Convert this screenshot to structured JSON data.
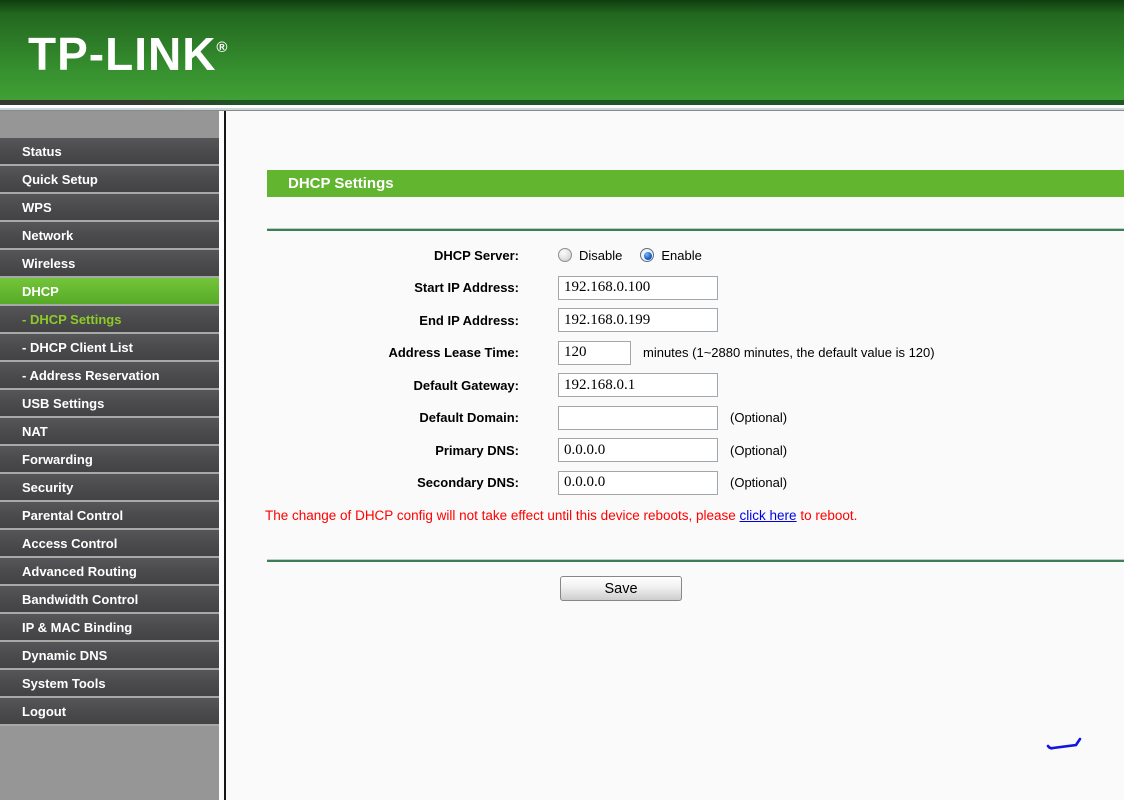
{
  "brand": {
    "name": "TP-LINK",
    "registered": "®"
  },
  "sidebar": {
    "items": [
      {
        "label": "Status"
      },
      {
        "label": "Quick Setup"
      },
      {
        "label": "WPS"
      },
      {
        "label": "Network"
      },
      {
        "label": "Wireless"
      },
      {
        "label": "DHCP",
        "active": true
      },
      {
        "label": "- DHCP Settings",
        "sub": true,
        "selected": true
      },
      {
        "label": "- DHCP Client List",
        "sub": true
      },
      {
        "label": "- Address Reservation",
        "sub": true
      },
      {
        "label": "USB Settings"
      },
      {
        "label": "NAT"
      },
      {
        "label": "Forwarding"
      },
      {
        "label": "Security"
      },
      {
        "label": "Parental Control"
      },
      {
        "label": "Access Control"
      },
      {
        "label": "Advanced Routing"
      },
      {
        "label": "Bandwidth Control"
      },
      {
        "label": "IP & MAC Binding"
      },
      {
        "label": "Dynamic DNS"
      },
      {
        "label": "System Tools"
      },
      {
        "label": "Logout"
      }
    ]
  },
  "page": {
    "title": "DHCP Settings",
    "dhcp_server_label": "DHCP Server:",
    "radio_options": [
      {
        "label": "Disable",
        "checked": false
      },
      {
        "label": "Enable",
        "checked": true
      }
    ],
    "fields": [
      {
        "label": "Start IP Address:",
        "value": "192.168.0.100",
        "size": "normal",
        "suffix": ""
      },
      {
        "label": "End IP Address:",
        "value": "192.168.0.199",
        "size": "normal",
        "suffix": ""
      },
      {
        "label": "Address Lease Time:",
        "value": "120",
        "size": "small",
        "suffix": "minutes (1~2880 minutes, the default value is 120)"
      },
      {
        "label": "Default Gateway:",
        "value": "192.168.0.1",
        "size": "normal",
        "suffix": ""
      },
      {
        "label": "Default Domain:",
        "value": "",
        "size": "normal",
        "suffix": "(Optional)"
      },
      {
        "label": "Primary DNS:",
        "value": "0.0.0.0",
        "size": "normal",
        "suffix": "(Optional)"
      },
      {
        "label": "Secondary DNS:",
        "value": "0.0.0.0",
        "size": "normal",
        "suffix": "(Optional)"
      }
    ],
    "warning": {
      "pre": "The change of DHCP config will not take effect until this device reboots, please ",
      "link_text": "click here",
      "post": " to reboot."
    },
    "save_label": "Save"
  },
  "colors": {
    "accent_green": "#62b52e",
    "submenu_selected_green": "#8ccc29",
    "separator_green": "#3e7d55",
    "sidebar_item_gray": "#4b4b4d",
    "sidebar_background": "#969696",
    "warning_red": "#ff0000",
    "link_blue": "#0000e8"
  }
}
